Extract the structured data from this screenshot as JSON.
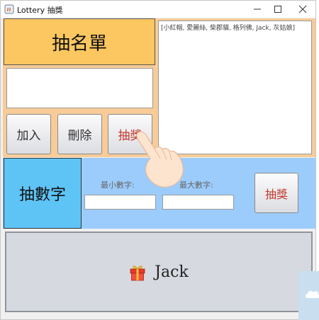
{
  "window": {
    "title": "Lottery 抽獎",
    "controls": [
      "minimize",
      "maximize",
      "close"
    ]
  },
  "names_panel": {
    "title": "抽名單",
    "name_input_value": "",
    "buttons": {
      "add": "加入",
      "delete": "刪除",
      "draw": "抽獎"
    },
    "list_text": "[小紅帽, 愛麗絲, 柴郡貓, 格列佛, Jack, 灰姑娘]"
  },
  "number_panel": {
    "title": "抽數字",
    "min_label": "最小數字:",
    "max_label": "最大數字:",
    "min_value": "",
    "max_value": "",
    "draw": "抽獎"
  },
  "result": {
    "icon": "gift-icon",
    "text": "Jack"
  },
  "colors": {
    "names_bg": "#f8cc98",
    "names_title_bg": "#fcc760",
    "number_bg": "#9cccfc",
    "number_title_bg": "#5ec4f5",
    "draw_text": "#c0392b",
    "result_bg": "#d7d9e0"
  }
}
